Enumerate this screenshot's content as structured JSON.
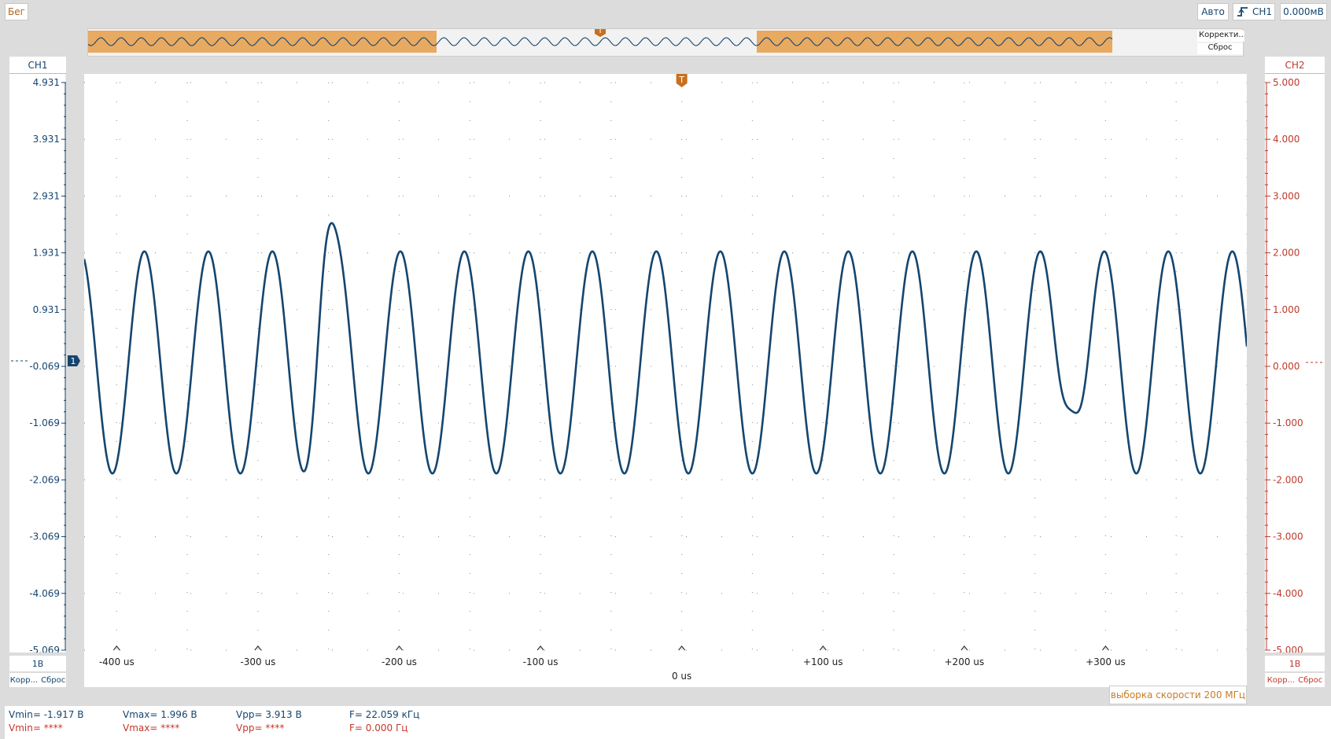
{
  "toolbar": {
    "run_label": "Бег",
    "mode_label": "Авто",
    "trigger_source": "CH1",
    "trigger_level": "0.000мВ",
    "trigger_edge_icon": "rising-edge-icon"
  },
  "overview": {
    "correction_label": "Корректи...",
    "reset_label": "Сброс",
    "trigger_marker": "T",
    "highlight_color": "#e8a961",
    "wave_color": "#15456f"
  },
  "channels": {
    "ch1": {
      "name": "CH1",
      "color": "#15456f",
      "ticks": [
        "4.931",
        "3.931",
        "2.931",
        "1.931",
        "0.931",
        "-0.069",
        "-1.069",
        "-2.069",
        "-3.069",
        "-4.069",
        "-5.069"
      ],
      "scale": "1В",
      "corr_label": "Корр...",
      "reset_label": "Сброс",
      "marker": "1"
    },
    "ch2": {
      "name": "CH2",
      "color": "#c0392b",
      "ticks": [
        "5.000",
        "4.000",
        "3.000",
        "2.000",
        "1.000",
        "0.000",
        "-1.000",
        "-2.000",
        "-3.000",
        "-4.000",
        "-5.000"
      ],
      "scale": "1В",
      "corr_label": "Корр...",
      "reset_label": "Сброс"
    }
  },
  "plot": {
    "trigger_marker": "T"
  },
  "x_axis": {
    "ticks": [
      "-400 us",
      "-300 us",
      "-200 us",
      "-100 us",
      "0 us",
      "+100 us",
      "+200 us",
      "+300 us"
    ]
  },
  "chart_data": {
    "type": "line",
    "x_range_us": [
      -423,
      400
    ],
    "y_range_volts": [
      -5.069,
      4.931
    ],
    "signal": {
      "shape": "sine",
      "amplitude_volts": 1.956,
      "offset_volts": 0.0,
      "period_us": 45.3,
      "zero_phase_at_us": -437
    },
    "glitches_at_us": [
      -253,
      276
    ],
    "glitch_depth_volts": 1.1
  },
  "footer": {
    "sample_rate": "выборка скорости 200 МГц",
    "ch1_measurements": {
      "vmin": "Vmin= -1.917 В",
      "vmax": "Vmax= 1.996 В",
      "vpp": "Vpp= 3.913 В",
      "freq": "F= 22.059 кГц"
    },
    "ch2_measurements": {
      "vmin": "Vmin= ****",
      "vmax": "Vmax= ****",
      "vpp": "Vpp= ****",
      "freq": "F= 0.000 Гц"
    }
  }
}
